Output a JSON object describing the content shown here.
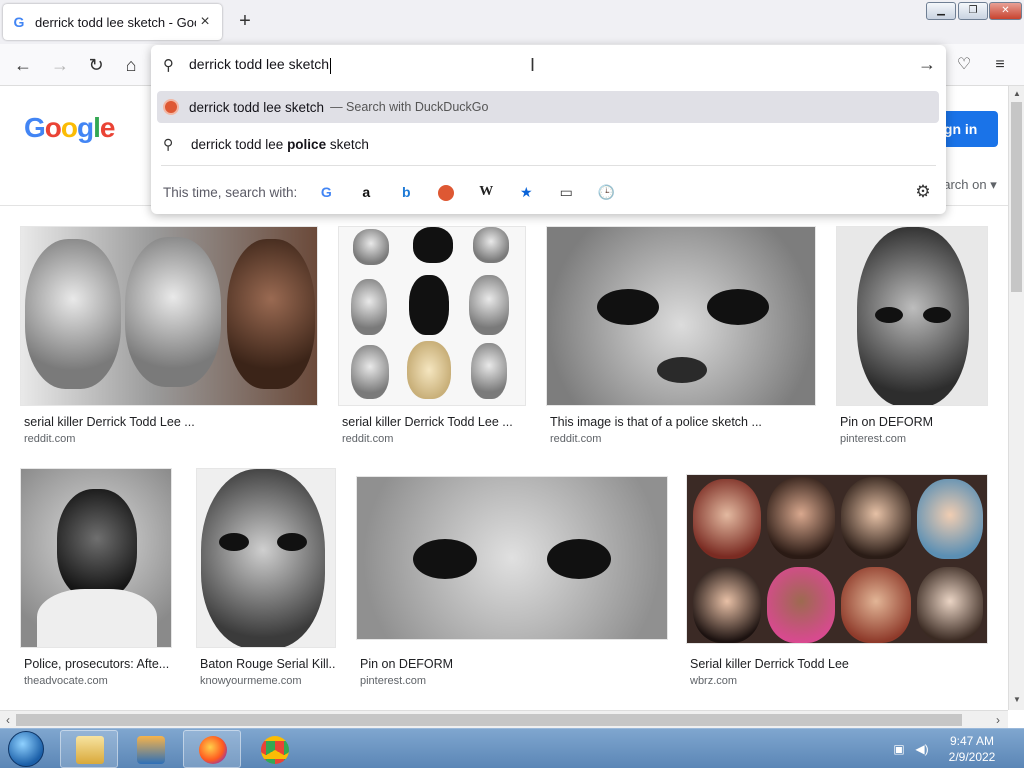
{
  "tab": {
    "title": "derrick todd lee sketch - Google",
    "favicon": "G"
  },
  "url_bar": {
    "value": "derrick todd lee sketch",
    "suggestions": [
      {
        "text": "derrick todd lee sketch",
        "suffix": "— Search with DuckDuckGo",
        "active": true
      },
      {
        "text_before": "derrick todd lee ",
        "text_bold": "police",
        "text_after": " sketch",
        "active": false
      }
    ],
    "one_off_label": "This time, search with:",
    "engines": [
      "G",
      "a",
      "b",
      "",
      "W",
      "★",
      "▭",
      "🕒"
    ]
  },
  "page": {
    "sign_in_label": "ign in",
    "search_on_label": "earch on ▾"
  },
  "images": [
    {
      "caption": "serial killer Derrick Todd Lee ...",
      "source": "reddit.com"
    },
    {
      "caption": "serial killer Derrick Todd Lee ...",
      "source": "reddit.com"
    },
    {
      "caption": "This image is that of a police sketch ...",
      "source": "reddit.com"
    },
    {
      "caption": "Pin on DEFORM",
      "source": "pinterest.com"
    },
    {
      "caption": "Police, prosecutors: Afte...",
      "source": "theadvocate.com"
    },
    {
      "caption": "Baton Rouge Serial Kill...",
      "source": "knowyourmeme.com"
    },
    {
      "caption": "Pin on DEFORM",
      "source": "pinterest.com"
    },
    {
      "caption": "Serial killer Derrick Todd Lee",
      "source": "wbrz.com"
    }
  ],
  "taskbar": {
    "time": "9:47 AM",
    "date": "2/9/2022"
  },
  "colors": {
    "accent": "#1a73e8",
    "ddg": "#de5833",
    "taskbar": "#5b86b6"
  }
}
